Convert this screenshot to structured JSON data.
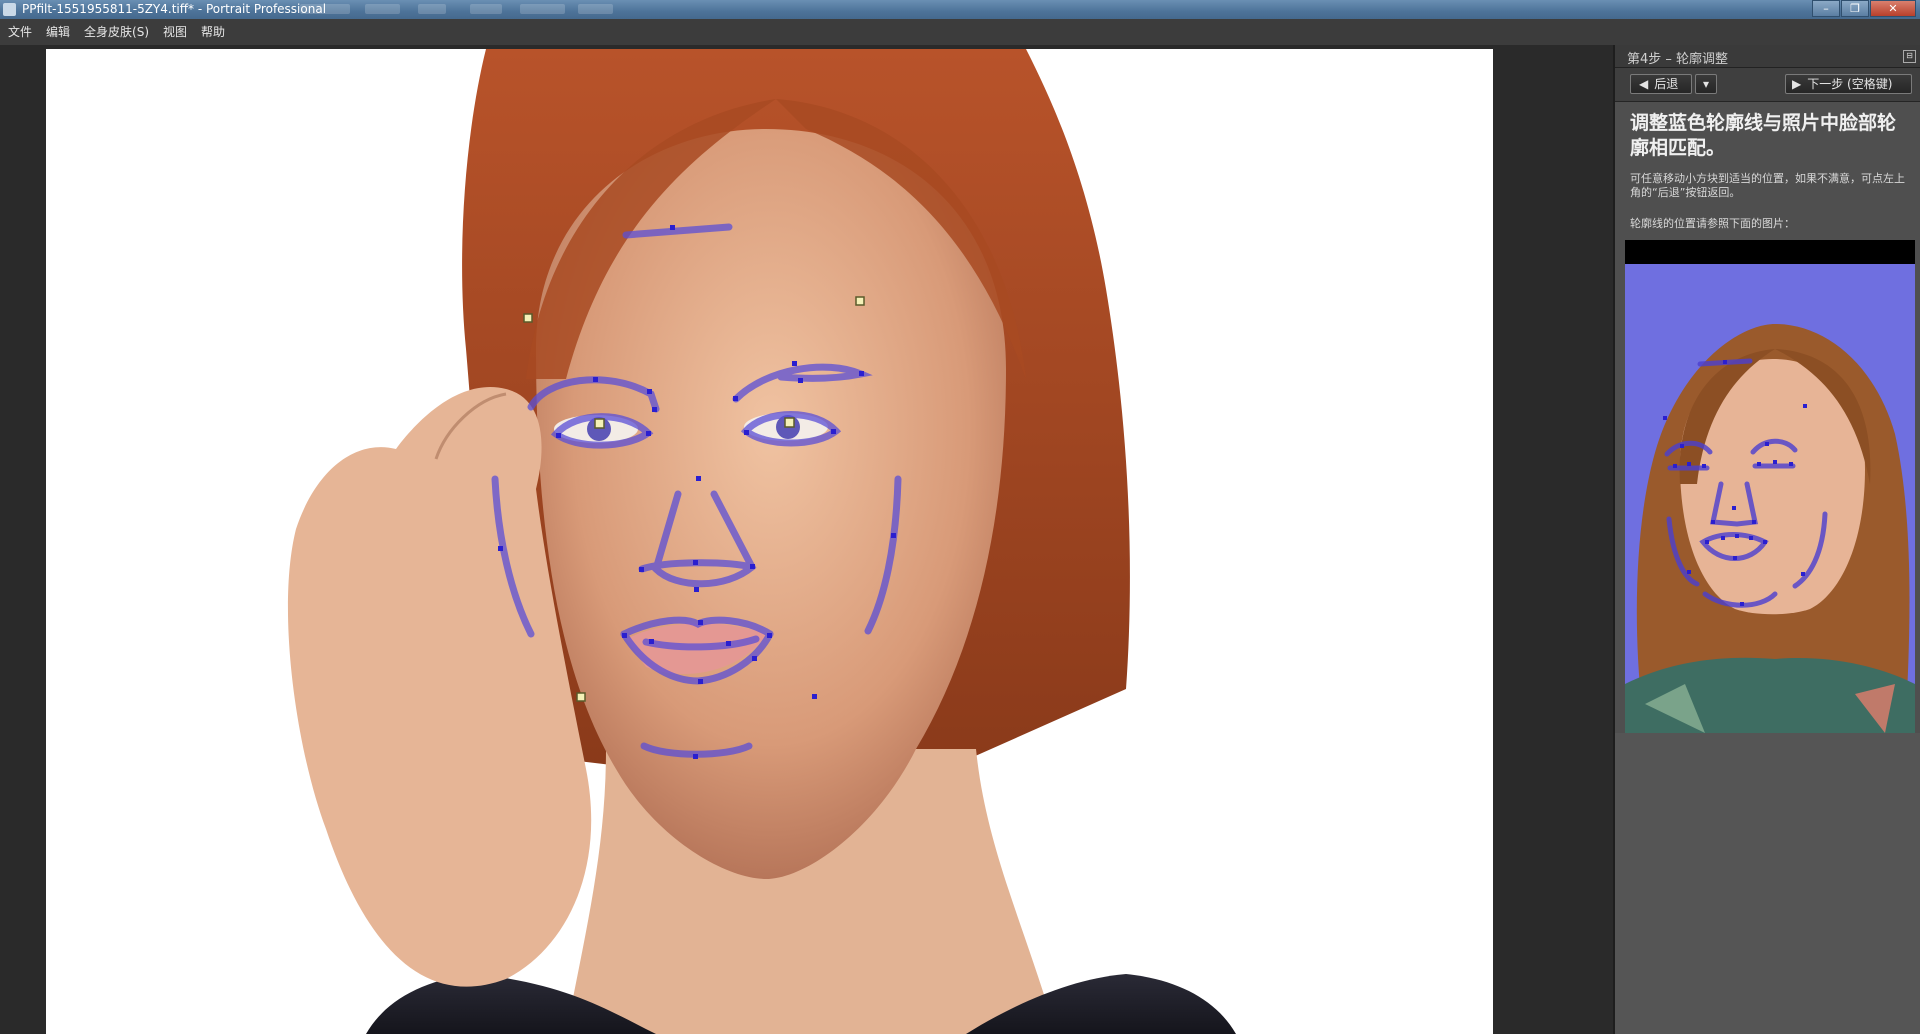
{
  "window": {
    "title": "PPfilt-1551955811-5ZY4.tiff* - Portrait Professional",
    "minimize_glyph": "–",
    "restore_glyph": "❐",
    "close_glyph": "✕"
  },
  "menu": [
    "文件",
    "编辑",
    "全身皮肤(S)",
    "视图",
    "帮助"
  ],
  "panel": {
    "step_title": "第4步 – 轮廓调整",
    "pin_glyph": "⊟",
    "back_label": "后退",
    "back_dropdown_glyph": "▾",
    "next_label": "下一步 (空格键)",
    "instruction_title": "调整蓝色轮廓线与照片中脸部轮廓相匹配。",
    "instruction_text": "可任意移动小方块到适当的位置，如果不满意，可点左上角的“后退”按钮返回。",
    "reference_text": "轮廓线的位置请参照下面的图片：",
    "reference_image": "reference-face-with-contour-guide"
  },
  "canvas": {
    "photo": "portrait-redhead-woman-hand-on-temple",
    "overlay_color": "#5b4fd6",
    "handle_color": "#2a1fd0",
    "anchor_color": "#f4f1b8"
  }
}
